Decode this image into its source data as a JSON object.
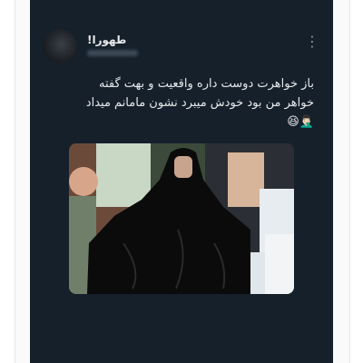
{
  "tweet": {
    "display_name": "طهورا!",
    "more_icon": "more-vertical-icon",
    "text_lines": [
      "باز خواهرت دوست داره واقعیت و بهت گفته",
      "خواهر من بود خودش میبرد نشون مامانم میداد"
    ],
    "emojis": "😆🤦🏻‍♂️",
    "media_alt_icon": "meme-photo"
  },
  "colors": {
    "card_bg": "#15202b",
    "text": "#e7e9ea",
    "muted": "#8b98a5"
  }
}
